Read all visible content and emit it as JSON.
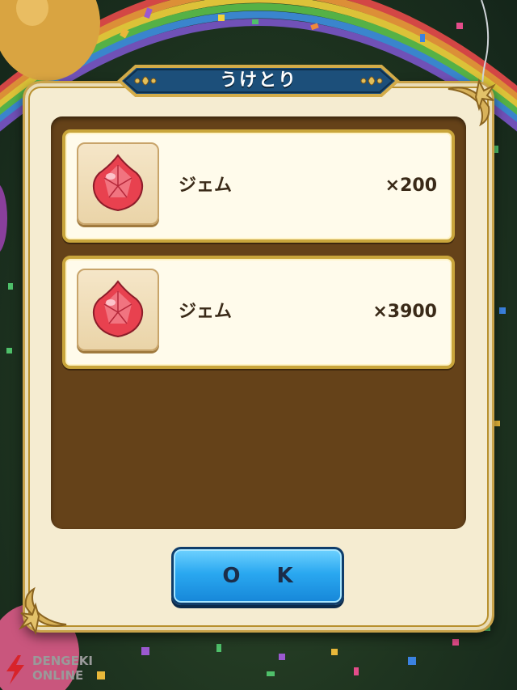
{
  "dialog": {
    "title": "うけとり",
    "ok_label": "O K"
  },
  "items": [
    {
      "name": "ジェム",
      "quantity": "×200",
      "icon": "red-gem-icon"
    },
    {
      "name": "ジェム",
      "quantity": "×3900",
      "icon": "red-gem-icon"
    }
  ],
  "watermark": {
    "line1": "DENGEKI",
    "line2": "ONLINE"
  },
  "colors": {
    "title_banner": "#1c4f7a",
    "panel": "#f5ecd1",
    "content_bg": "#654219",
    "ok_button": "#2aa8f0",
    "gem": "#e8414f"
  }
}
